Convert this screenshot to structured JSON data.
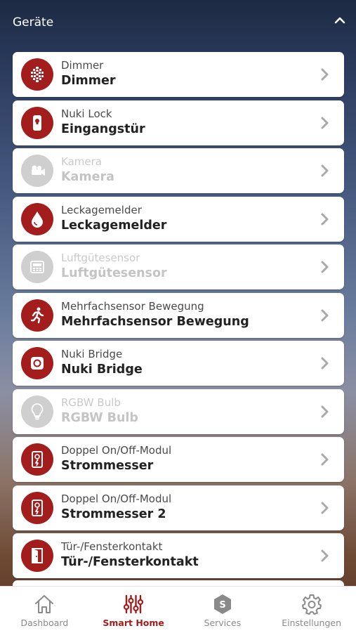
{
  "header": {
    "title": "Geräte"
  },
  "colors": {
    "accent": "#a31d1d",
    "disabled_icon": "#cfcfcf",
    "tab_inactive": "#8a8a8a"
  },
  "devices": [
    {
      "type": "Dimmer",
      "name": "Dimmer",
      "icon": "dimmer-icon",
      "enabled": true
    },
    {
      "type": "Nuki Lock",
      "name": "Eingangstür",
      "icon": "lock-icon",
      "enabled": true
    },
    {
      "type": "Kamera",
      "name": "Kamera",
      "icon": "camera-icon",
      "enabled": false
    },
    {
      "type": "Leckagemelder",
      "name": "Leckagemelder",
      "icon": "water-drop-icon",
      "enabled": true
    },
    {
      "type": "Luftgütesensor",
      "name": "Luftgütesensor",
      "icon": "air-quality-icon",
      "enabled": false
    },
    {
      "type": "Mehrfachsensor Bewegung",
      "name": "Mehrfachsensor Bewegung",
      "icon": "motion-icon",
      "enabled": true
    },
    {
      "type": "Nuki Bridge",
      "name": "Nuki Bridge",
      "icon": "bridge-icon",
      "enabled": true
    },
    {
      "type": "RGBW Bulb",
      "name": "RGBW Bulb",
      "icon": "bulb-icon",
      "enabled": false
    },
    {
      "type": "Doppel On/Off-Modul",
      "name": "Strommesser",
      "icon": "power-outlet-icon",
      "enabled": true
    },
    {
      "type": "Doppel On/Off-Modul",
      "name": "Strommesser 2",
      "icon": "power-outlet-icon",
      "enabled": true
    },
    {
      "type": "Tür-/Fensterkontakt",
      "name": "Tür-/Fensterkontakt",
      "icon": "door-icon",
      "enabled": true
    }
  ],
  "tabs": [
    {
      "label": "Dashboard",
      "icon": "home-icon",
      "active": false
    },
    {
      "label": "Smart Home",
      "icon": "sliders-icon",
      "active": true
    },
    {
      "label": "Services",
      "icon": "services-icon",
      "active": false
    },
    {
      "label": "Einstellungen",
      "icon": "gear-icon",
      "active": false
    }
  ],
  "services_badge": "S"
}
